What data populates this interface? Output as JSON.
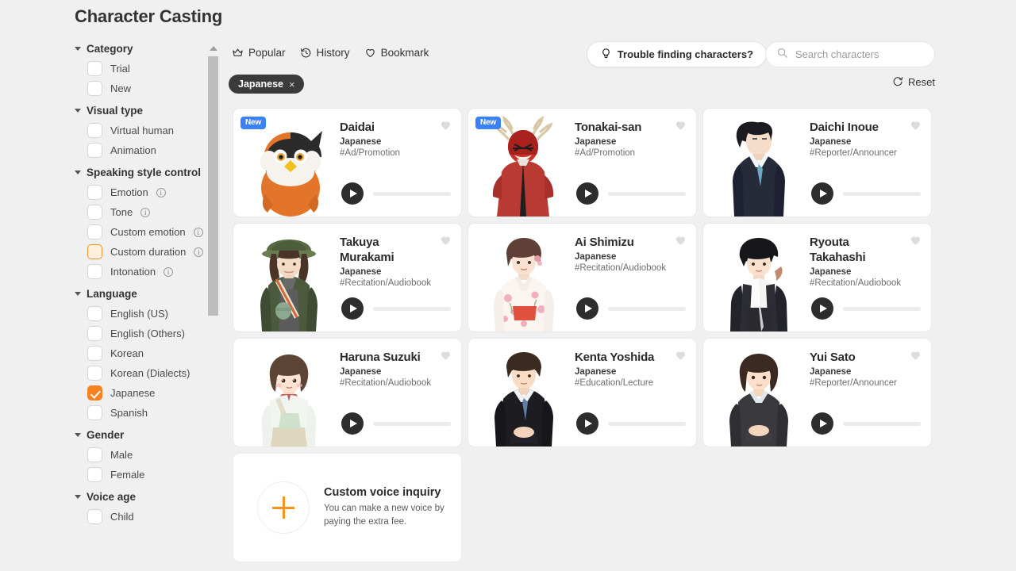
{
  "page": {
    "title": "Character Casting"
  },
  "sidebar": {
    "groups": [
      {
        "title": "Category",
        "options": [
          {
            "label": "Trial",
            "state": "unchecked",
            "info": false
          },
          {
            "label": "New",
            "state": "unchecked",
            "info": false
          }
        ]
      },
      {
        "title": "Visual type",
        "options": [
          {
            "label": "Virtual human",
            "state": "unchecked",
            "info": false
          },
          {
            "label": "Animation",
            "state": "unchecked",
            "info": false
          }
        ]
      },
      {
        "title": "Speaking style control",
        "options": [
          {
            "label": "Emotion",
            "state": "unchecked",
            "info": true
          },
          {
            "label": "Tone",
            "state": "unchecked",
            "info": true
          },
          {
            "label": "Custom emotion",
            "state": "unchecked",
            "info": true
          },
          {
            "label": "Custom duration",
            "state": "accent",
            "info": true
          },
          {
            "label": "Intonation",
            "state": "unchecked",
            "info": true
          }
        ]
      },
      {
        "title": "Language",
        "options": [
          {
            "label": "English (US)",
            "state": "unchecked",
            "info": false
          },
          {
            "label": "English (Others)",
            "state": "unchecked",
            "info": false
          },
          {
            "label": "Korean",
            "state": "unchecked",
            "info": false
          },
          {
            "label": "Korean (Dialects)",
            "state": "unchecked",
            "info": false
          },
          {
            "label": "Japanese",
            "state": "checked",
            "info": false
          },
          {
            "label": "Spanish",
            "state": "unchecked",
            "info": false
          }
        ]
      },
      {
        "title": "Gender",
        "options": [
          {
            "label": "Male",
            "state": "unchecked",
            "info": false
          },
          {
            "label": "Female",
            "state": "unchecked",
            "info": false
          }
        ]
      },
      {
        "title": "Voice age",
        "options": [
          {
            "label": "Child",
            "state": "unchecked",
            "info": false
          }
        ]
      }
    ]
  },
  "toolbar": {
    "tabs": [
      {
        "label": "Popular",
        "icon": "crown-icon"
      },
      {
        "label": "History",
        "icon": "history-icon"
      },
      {
        "label": "Bookmark",
        "icon": "heart-outline-icon"
      }
    ],
    "trouble_label": "Trouble finding characters?",
    "search_placeholder": "Search characters",
    "search_value": "",
    "reset_label": "Reset"
  },
  "filter_chips": [
    {
      "label": "Japanese",
      "remove": "×"
    }
  ],
  "colors": {
    "accent": "#f5821f",
    "badge_new": "#3b82f6",
    "chip_bg": "#3b3b3b",
    "page_bg": "#f0f0f0"
  },
  "cards": [
    {
      "name": "Daidai",
      "language": "Japanese",
      "tag": "#Ad/Promotion",
      "badge": "New",
      "art": "owl"
    },
    {
      "name": "Tonakai-san",
      "language": "Japanese",
      "tag": "#Ad/Promotion",
      "badge": "New",
      "art": "reindeer"
    },
    {
      "name": "Daichi Inoue",
      "language": "Japanese",
      "tag": "#Reporter/Announcer",
      "badge": "",
      "art": "suit-man-navy"
    },
    {
      "name": "Takuya Murakami",
      "language": "Japanese",
      "tag": "#Recitation/Audiobook",
      "badge": "",
      "art": "hiker"
    },
    {
      "name": "Ai Shimizu",
      "language": "Japanese",
      "tag": "#Recitation/Audiobook",
      "badge": "",
      "art": "kimono-woman"
    },
    {
      "name": "Ryouta Takahashi",
      "language": "Japanese",
      "tag": "#Recitation/Audiobook",
      "badge": "",
      "art": "casual-man"
    },
    {
      "name": "Haruna Suzuki",
      "language": "Japanese",
      "tag": "#Recitation/Audiobook",
      "badge": "",
      "art": "casual-woman"
    },
    {
      "name": "Kenta Yoshida",
      "language": "Japanese",
      "tag": "#Education/Lecture",
      "badge": "",
      "art": "suit-man-black"
    },
    {
      "name": "Yui Sato",
      "language": "Japanese",
      "tag": "#Reporter/Announcer",
      "badge": "",
      "art": "suit-woman"
    }
  ],
  "inquiry": {
    "title": "Custom voice inquiry",
    "desc": "You can make a new voice by paying the extra fee."
  }
}
